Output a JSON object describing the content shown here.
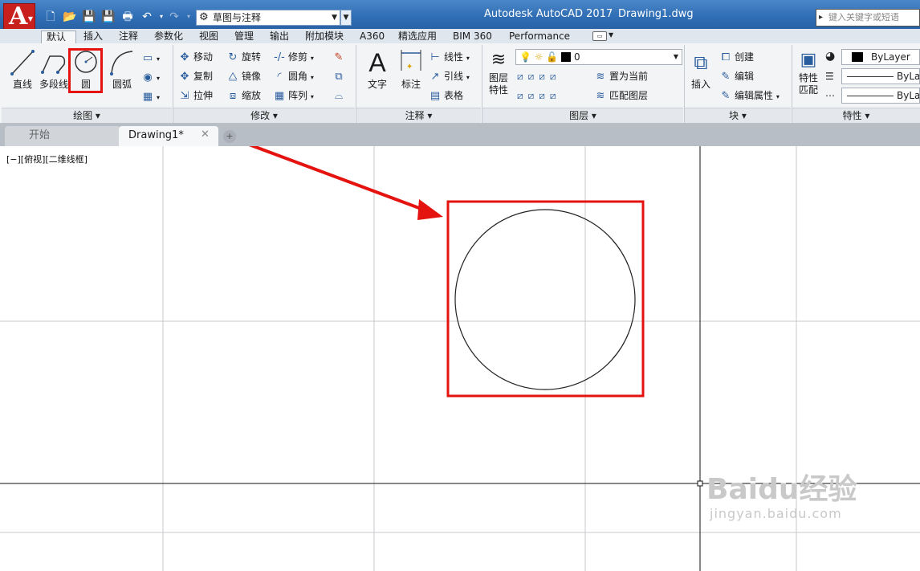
{
  "titlebar": {
    "app_title": "Autodesk AutoCAD 2017",
    "doc_title": "Drawing1.dwg",
    "workspace": "草图与注释",
    "search_placeholder": "键入关键字或短语"
  },
  "ribbon_tabs": [
    "默认",
    "插入",
    "注释",
    "参数化",
    "视图",
    "管理",
    "输出",
    "附加模块",
    "A360",
    "精选应用",
    "BIM 360",
    "Performance"
  ],
  "panels": {
    "draw": {
      "title": "绘图",
      "line": "直线",
      "polyline": "多段线",
      "circle": "圆",
      "arc": "圆弧"
    },
    "modify": {
      "title": "修改",
      "move": "移动",
      "rotate": "旋转",
      "trim": "修剪",
      "copy": "复制",
      "mirror": "镜像",
      "fillet": "圆角",
      "stretch": "拉伸",
      "scale": "缩放",
      "array": "阵列"
    },
    "annotation": {
      "title": "注释",
      "text": "文字",
      "dimension": "标注",
      "linear": "线性",
      "leader": "引线",
      "table": "表格"
    },
    "layers": {
      "title": "图层",
      "layer_props": "图层特性",
      "current_layer": "0",
      "make_current": "置为当前",
      "match_layer": "匹配图层"
    },
    "block": {
      "title": "块",
      "insert": "插入",
      "create": "创建",
      "edit": "编辑",
      "edit_attributes": "编辑属性"
    },
    "properties": {
      "title": "特性",
      "match_properties": "特性匹配",
      "color": "ByLayer",
      "linetype": "ByLayer",
      "lineweight": "ByLayer"
    }
  },
  "file_tabs": {
    "start": "开始",
    "drawing": "Drawing1*"
  },
  "viewport": {
    "label": "[−][俯视][二维线框]"
  },
  "watermark": {
    "brand": "Baidu经验",
    "url": "jingyan.baidu.com"
  },
  "colors": {
    "highlight": "#e4130f",
    "titlebar": "#2f6db4",
    "logo": "#c8201c"
  }
}
